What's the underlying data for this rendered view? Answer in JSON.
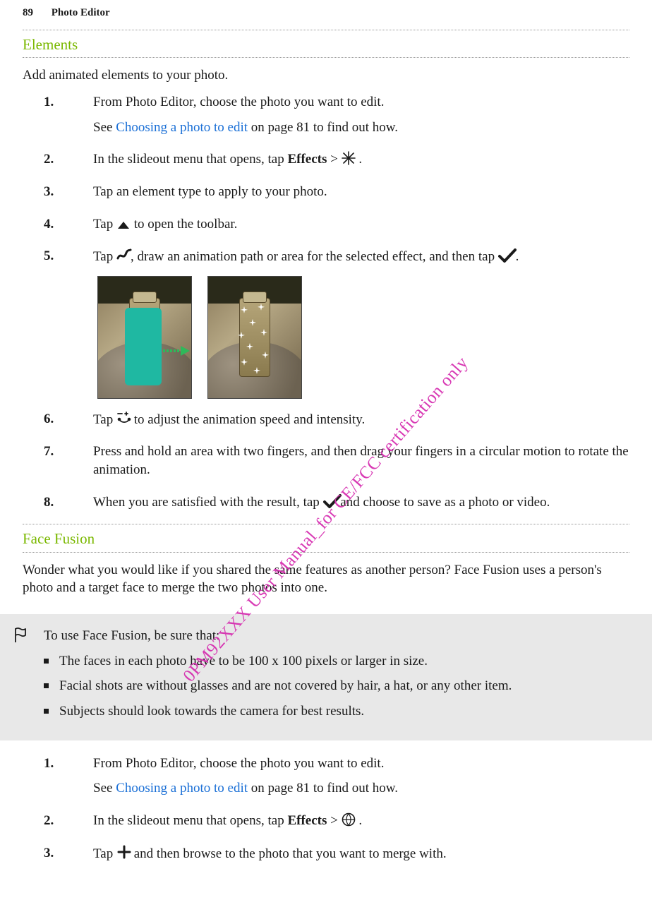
{
  "page_header": {
    "page_number": "89",
    "chapter": "Photo Editor"
  },
  "watermark": "0PM92XXX User Manual_for CE/FCC certification only",
  "elements": {
    "heading": "Elements",
    "intro": "Add animated elements to your photo.",
    "steps": {
      "s1": {
        "no": "1.",
        "line": "From Photo Editor, choose the photo you want to edit.",
        "sub_prefix": "See ",
        "sub_link": "Choosing a photo to edit",
        "sub_suffix": " on page 81 to find out how."
      },
      "s2": {
        "no": "2.",
        "prefix": "In the slideout menu that opens, tap ",
        "effects": "Effects",
        "gt": " > ",
        "suffix": " ."
      },
      "s3": {
        "no": "3.",
        "text": "Tap an element type to apply to your photo."
      },
      "s4": {
        "no": "4.",
        "prefix": "Tap ",
        "suffix": " to open the toolbar."
      },
      "s5": {
        "no": "5.",
        "prefix": "Tap ",
        "mid": ", draw an animation path or area for the selected effect, and then tap ",
        "suffix": " ."
      },
      "s6": {
        "no": "6.",
        "prefix": "Tap ",
        "suffix": " to adjust the animation speed and intensity."
      },
      "s7": {
        "no": "7.",
        "text": "Press and hold an area with two fingers, and then drag your fingers in a circular motion to rotate the animation."
      },
      "s8": {
        "no": "8.",
        "prefix": "When you are satisfied with the result, tap ",
        "suffix": " and choose to save as a photo or video."
      }
    }
  },
  "face_fusion": {
    "heading": "Face Fusion",
    "intro": "Wonder what you would like if you shared the same features as another person? Face Fusion uses a person's photo and a target face to merge the two photos into one.",
    "info_lead": "To use Face Fusion, be sure that:",
    "info_bullets": {
      "b1": "The faces in each photo have to be 100 x 100 pixels or larger in size.",
      "b2": "Facial shots are without glasses and are not covered by hair, a hat, or any other item.",
      "b3": "Subjects should look towards the camera for best results."
    },
    "steps": {
      "s1": {
        "no": "1.",
        "line": "From Photo Editor, choose the photo you want to edit.",
        "sub_prefix": "See ",
        "sub_link": "Choosing a photo to edit",
        "sub_suffix": " on page 81 to find out how."
      },
      "s2": {
        "no": "2.",
        "prefix": "In the slideout menu that opens, tap ",
        "effects": "Effects",
        "gt": " > ",
        "suffix": " ."
      },
      "s3": {
        "no": "3.",
        "prefix": "Tap ",
        "suffix": " and then browse to the photo that you want to merge with."
      }
    }
  }
}
